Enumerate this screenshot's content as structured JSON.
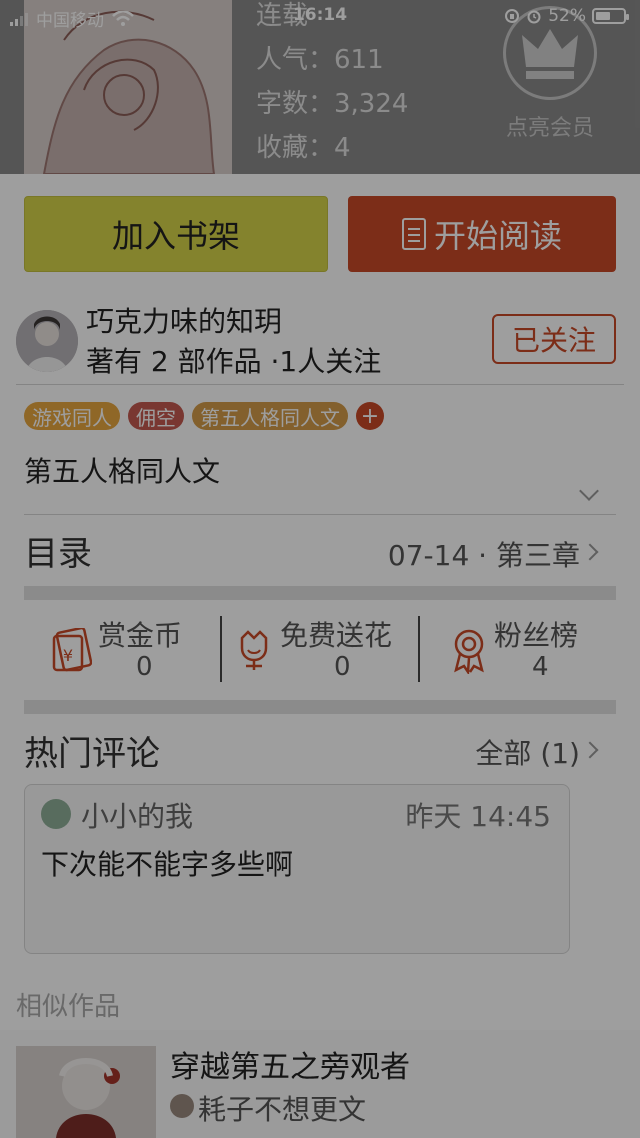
{
  "statusbar": {
    "carrier": "中国移动",
    "time": "16:14",
    "battery": "52%"
  },
  "book": {
    "status": "连载",
    "popularity": "人气：611",
    "word_count": "字数：3,324",
    "favorites": "收藏：4"
  },
  "vip": {
    "label": "点亮会员",
    "icon": "crown-icon"
  },
  "actions": {
    "add_shelf": "加入书架",
    "start_read": "开始阅读"
  },
  "author": {
    "name": "巧克力味的知玥",
    "stats": "著有 2 部作品 ·1人关注",
    "follow_label": "已关注"
  },
  "tags": [
    {
      "label": "游戏同人",
      "color": "#e7a640"
    },
    {
      "label": "佣空",
      "color": "#c45a4f"
    },
    {
      "label": "第五人格同人文",
      "color": "#d39c49"
    }
  ],
  "tag_add": "+",
  "description": "第五人格同人文",
  "toc": {
    "title": "目录",
    "latest": "07-14 · 第三章"
  },
  "stats": {
    "reward": {
      "label": "赏金币",
      "value": "0",
      "icon": "red-envelope-icon"
    },
    "flowers": {
      "label": "免费送花",
      "value": "0",
      "icon": "flower-icon"
    },
    "fans": {
      "label": "粉丝榜",
      "value": "4",
      "icon": "award-ribbon-icon"
    }
  },
  "comments": {
    "title": "热门评论",
    "all_label": "全部 (1)",
    "items": [
      {
        "user": "小小的我",
        "time": "昨天 14:45",
        "text": "下次能不能字多些啊"
      }
    ]
  },
  "similar": {
    "title": "相似作品",
    "items": [
      {
        "name": "穿越第五之旁观者",
        "author": "耗子不想更文"
      }
    ]
  },
  "colors": {
    "accent": "#c94a27",
    "shelf_button": "#d6d34a"
  }
}
